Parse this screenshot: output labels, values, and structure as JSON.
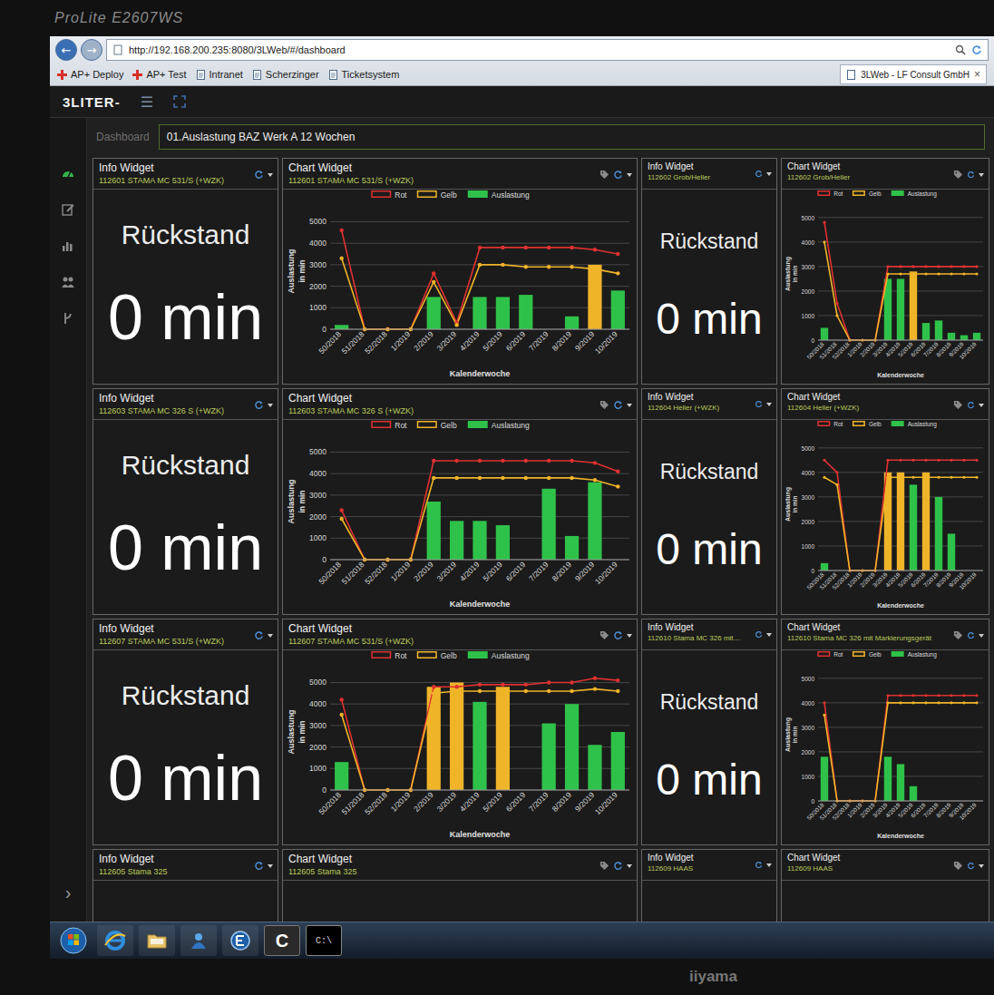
{
  "monitor": {
    "model": "ProLite E2607WS",
    "brand": "iiyama"
  },
  "browser": {
    "back": "←",
    "forward": "→",
    "url": "http://192.168.200.235:8080/3LWeb/#/dashboard",
    "bookmarks": [
      {
        "label": "AP+ Deploy"
      },
      {
        "label": "AP+ Test"
      },
      {
        "label": "Intranet"
      },
      {
        "label": "Scherzinger"
      },
      {
        "label": "Ticketsystem"
      }
    ],
    "tab": {
      "title": "3LWeb - LF Consult GmbH",
      "close": "×",
      "selected": true
    }
  },
  "app": {
    "logo": "3LITER-",
    "menu": "☰"
  },
  "sidebar": {
    "items": [
      {
        "selected": true
      },
      {
        "selected": false
      },
      {
        "selected": false
      },
      {
        "selected": false
      },
      {
        "selected": false
      }
    ],
    "expand": "›"
  },
  "dashboard": {
    "label": "Dashboard",
    "value": "01.Auslastung BAZ Werk A 12 Wochen"
  },
  "axis": {
    "y_title": "Auslastung",
    "y_unit": "in min",
    "x_title": "Kalenderwoche",
    "y_ticks": [
      "0",
      "1000",
      "2000",
      "3000",
      "4000",
      "5000"
    ],
    "x_labels": [
      "50/2018",
      "51/2018",
      "52/2018",
      "1/2019",
      "2/2019",
      "3/2019",
      "4/2019",
      "5/2019",
      "6/2019",
      "7/2019",
      "8/2019",
      "9/2019",
      "10/2019"
    ],
    "legend": [
      {
        "label": "Rot",
        "kind": "line",
        "color": "#e03131"
      },
      {
        "label": "Gelb",
        "kind": "line",
        "color": "#f0b429"
      },
      {
        "label": "Auslastung",
        "kind": "bar",
        "color": "#2fc24a"
      }
    ]
  },
  "rows": [
    {
      "info": {
        "title": "Info Widget",
        "subtitle": "112601 STAMA MC 531/S (+WZK)",
        "label": "Rückstand",
        "value": "0 min"
      },
      "chart": {
        "title": "Chart Widget",
        "subtitle": "112601 STAMA MC 531/S (+WZK)",
        "rot": [
          4600,
          0,
          0,
          0,
          2600,
          300,
          3800,
          3800,
          3800,
          3800,
          3800,
          3700,
          3500
        ],
        "gelb": [
          3300,
          0,
          0,
          0,
          2200,
          200,
          3000,
          3000,
          2900,
          2900,
          2900,
          2800,
          2600
        ],
        "auslastung": [
          200,
          0,
          0,
          0,
          1500,
          0,
          1500,
          1500,
          1600,
          0,
          600,
          3000,
          1800
        ]
      },
      "side_info": {
        "title": "Info Widget",
        "subtitle": "112602 Grob/Heller",
        "label": "Rückstand",
        "value": "0 min"
      },
      "side_chart": {
        "title": "Chart Widget",
        "subtitle": "112602 Grob/Heller",
        "rot": [
          4800,
          1500,
          0,
          0,
          0,
          3000,
          3000,
          3000,
          3000,
          3000,
          3000,
          3000,
          3000
        ],
        "gelb": [
          4000,
          1000,
          0,
          0,
          0,
          2700,
          2700,
          2700,
          2700,
          2700,
          2700,
          2700,
          2700
        ],
        "auslastung": [
          500,
          0,
          0,
          0,
          0,
          2500,
          2500,
          2800,
          700,
          800,
          300,
          200,
          300
        ]
      }
    },
    {
      "info": {
        "title": "Info Widget",
        "subtitle": "112603 STAMA MC 326 S (+WZK)",
        "label": "Rückstand",
        "value": "0 min"
      },
      "chart": {
        "title": "Chart Widget",
        "subtitle": "112603 STAMA MC 326 S (+WZK)",
        "rot": [
          2300,
          0,
          0,
          0,
          4600,
          4600,
          4600,
          4600,
          4600,
          4600,
          4600,
          4500,
          4100
        ],
        "gelb": [
          1900,
          0,
          0,
          0,
          3800,
          3800,
          3800,
          3800,
          3800,
          3800,
          3800,
          3700,
          3400
        ],
        "auslastung": [
          0,
          0,
          0,
          0,
          2700,
          1800,
          1800,
          1600,
          0,
          3300,
          1100,
          3600,
          0
        ]
      },
      "side_info": {
        "title": "Info Widget",
        "subtitle": "112604 Heller (+WZK)",
        "label": "Rückstand",
        "value": "0 min"
      },
      "side_chart": {
        "title": "Chart Widget",
        "subtitle": "112604 Heller (+WZK)",
        "rot": [
          4500,
          4000,
          0,
          0,
          0,
          4500,
          4500,
          4500,
          4500,
          4500,
          4500,
          4500,
          4500
        ],
        "gelb": [
          3800,
          3500,
          0,
          0,
          0,
          3800,
          3800,
          3800,
          3800,
          3800,
          3800,
          3800,
          3800
        ],
        "auslastung": [
          300,
          0,
          0,
          0,
          0,
          4000,
          4000,
          3500,
          4000,
          3000,
          1500,
          0,
          0
        ]
      }
    },
    {
      "info": {
        "title": "Info Widget",
        "subtitle": "112607 STAMA MC 531/S (+WZK)",
        "label": "Rückstand",
        "value": "0 min"
      },
      "chart": {
        "title": "Chart Widget",
        "subtitle": "112607 STAMA MC 531/S (+WZK)",
        "rot": [
          4200,
          0,
          0,
          0,
          4800,
          4800,
          4900,
          4900,
          4900,
          5000,
          5000,
          5200,
          5100
        ],
        "gelb": [
          3500,
          0,
          0,
          0,
          4500,
          4600,
          4600,
          4600,
          4600,
          4600,
          4600,
          4700,
          4600
        ],
        "auslastung": [
          1300,
          0,
          0,
          0,
          4800,
          5000,
          4100,
          4800,
          0,
          3100,
          4000,
          2100,
          2700
        ]
      },
      "side_info": {
        "title": "Info Widget",
        "subtitle": "112610 Stama MC 326 mit…",
        "label": "Rückstand",
        "value": "0 min"
      },
      "side_chart": {
        "title": "Chart Widget",
        "subtitle": "112610 Stama MC 326 mit Markierungsgerät",
        "rot": [
          4000,
          0,
          0,
          0,
          0,
          4300,
          4300,
          4300,
          4300,
          4300,
          4300,
          4300,
          4300
        ],
        "gelb": [
          3500,
          0,
          0,
          0,
          0,
          4000,
          4000,
          4000,
          4000,
          4000,
          4000,
          4000,
          4000
        ],
        "auslastung": [
          1800,
          0,
          0,
          0,
          0,
          1800,
          1500,
          600,
          0,
          0,
          0,
          0,
          0
        ]
      }
    },
    {
      "info": {
        "title": "Info Widget",
        "subtitle": "112605 Stama 325"
      },
      "chart": {
        "title": "Chart Widget",
        "subtitle": "112605 Stama 325"
      },
      "side_info": {
        "title": "Info Widget",
        "subtitle": "112609 HAAS"
      },
      "side_chart": {
        "title": "Chart Widget",
        "subtitle": "112609 HAAS"
      }
    }
  ],
  "taskbar": {
    "tile": "C",
    "cmd": "C:\\"
  }
}
